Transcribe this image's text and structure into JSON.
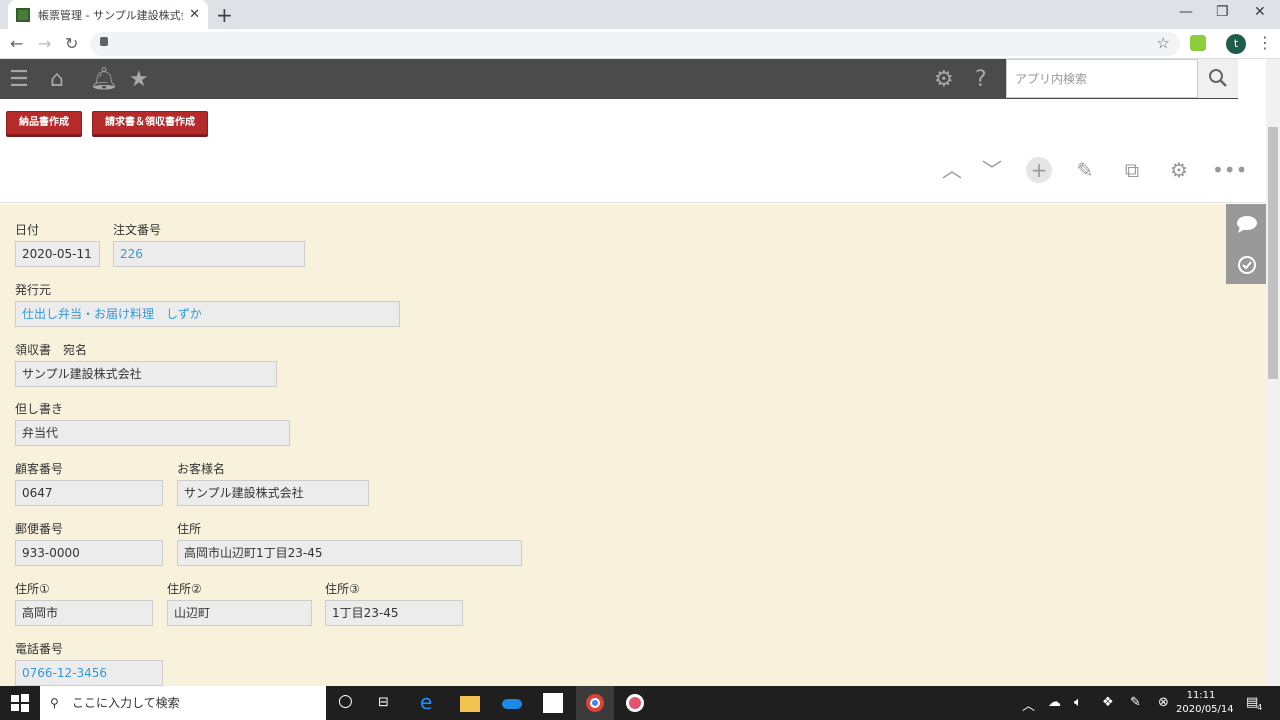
{
  "browser": {
    "tab_title": "帳票管理 - サンプル建設株式会社",
    "tab_close": "✕",
    "new_tab": "+",
    "window_minimize": "—",
    "window_restore": "❐",
    "window_close": "✕",
    "avatar_letter": "t"
  },
  "app": {
    "search_placeholder": "アプリ内検索"
  },
  "actions": {
    "delivery_button": "納品書作成",
    "invoice_button": "請求書＆領収書作成"
  },
  "form": {
    "date_label": "日付",
    "date_value": "2020-05-11",
    "order_no_label": "注文番号",
    "order_no_value": "226",
    "issuer_label": "発行元",
    "issuer_value": "仕出し弁当・お届け料理　しずか",
    "receipt_to_label": "領収書　宛名",
    "receipt_to_value": "サンプル建設株式会社",
    "proviso_label": "但し書き",
    "proviso_value": "弁当代",
    "customer_no_label": "顧客番号",
    "customer_no_value": "0647",
    "customer_name_label": "お客様名",
    "customer_name_value": "サンプル建設株式会社",
    "zip_label": "郵便番号",
    "zip_value": "933-0000",
    "address_label": "住所",
    "address_value": "高岡市山辺町1丁目23-45",
    "address1_label": "住所①",
    "address1_value": "高岡市",
    "address2_label": "住所②",
    "address2_value": "山辺町",
    "address3_label": "住所③",
    "address3_value": "1丁目23-45",
    "phone_label": "電話番号",
    "phone_value": "0766-12-3456"
  },
  "taskbar": {
    "search_text": "ここに入力して検索",
    "time": "11:11",
    "date": "2020/05/14",
    "notification_count": "4"
  }
}
